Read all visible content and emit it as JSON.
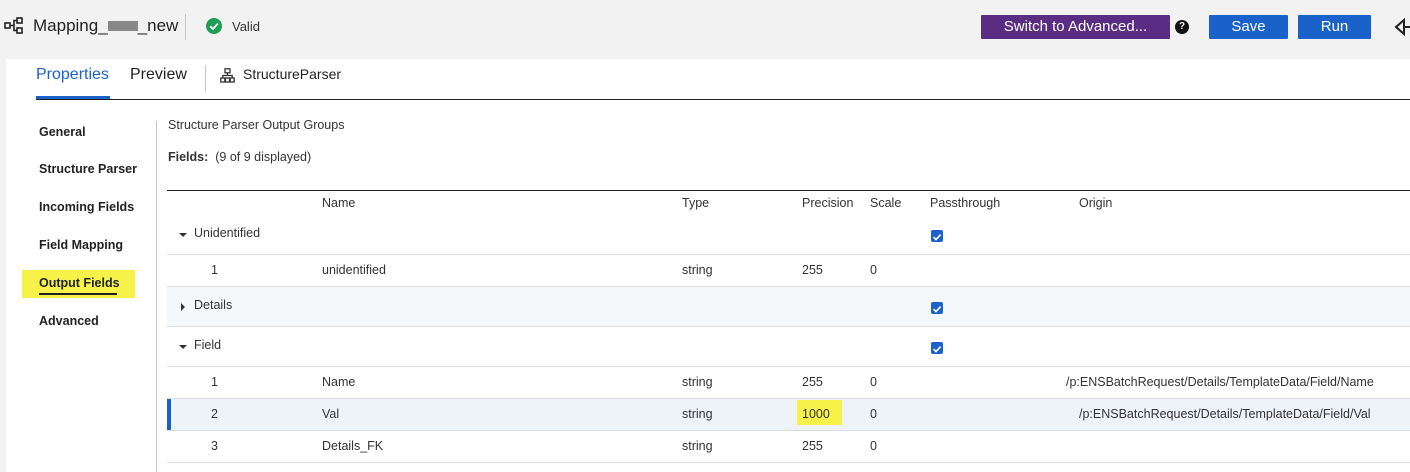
{
  "header": {
    "mapping_title_prefix": "Mapping_",
    "mapping_title_suffix": "_new",
    "status": "Valid",
    "switch_label": "Switch to Advanced...",
    "help_label": "?",
    "save_label": "Save",
    "run_label": "Run"
  },
  "tabs": {
    "properties": "Properties",
    "preview": "Preview",
    "transformation": "StructureParser"
  },
  "nav": {
    "items": [
      "General",
      "Structure Parser",
      "Incoming Fields",
      "Field Mapping",
      "Output Fields",
      "Advanced"
    ],
    "selected": "Output Fields"
  },
  "content": {
    "section_title": "Structure Parser Output Groups",
    "fields_label": "Fields:",
    "fields_count": "(9 of 9 displayed)"
  },
  "table": {
    "columns": [
      "Name",
      "Type",
      "Precision",
      "Scale",
      "Passthrough",
      "Origin"
    ],
    "groups": [
      {
        "name": "Unidentified",
        "expanded": true,
        "passthrough": true,
        "rows": [
          {
            "num": "1",
            "name": "unidentified",
            "type": "string",
            "precision": "255",
            "scale": "0",
            "origin": ""
          }
        ]
      },
      {
        "name": "Details",
        "expanded": false,
        "passthrough": true,
        "rows": []
      },
      {
        "name": "Field",
        "expanded": true,
        "passthrough": true,
        "rows": [
          {
            "num": "1",
            "name": "Name",
            "type": "string",
            "precision": "255",
            "scale": "0",
            "origin": "/p:ENSBatchRequest/Details/TemplateData/Field/Name"
          },
          {
            "num": "2",
            "name": "Val",
            "type": "string",
            "precision": "1000",
            "scale": "0",
            "origin": "/p:ENSBatchRequest/Details/TemplateData/Field/Val",
            "selected": true
          },
          {
            "num": "3",
            "name": "Details_FK",
            "type": "string",
            "precision": "255",
            "scale": "0",
            "origin": ""
          }
        ]
      }
    ]
  },
  "colors": {
    "accent": "#1a62c9",
    "advanced_button": "#5b2c83",
    "valid": "#1f9d55",
    "highlight": "#f7f24a"
  },
  "icons": [
    "mapping-icon",
    "valid-check-icon",
    "help-icon",
    "back-icon",
    "structure-icon",
    "caret-down-icon",
    "caret-right-icon",
    "checkbox-checked-icon"
  ]
}
